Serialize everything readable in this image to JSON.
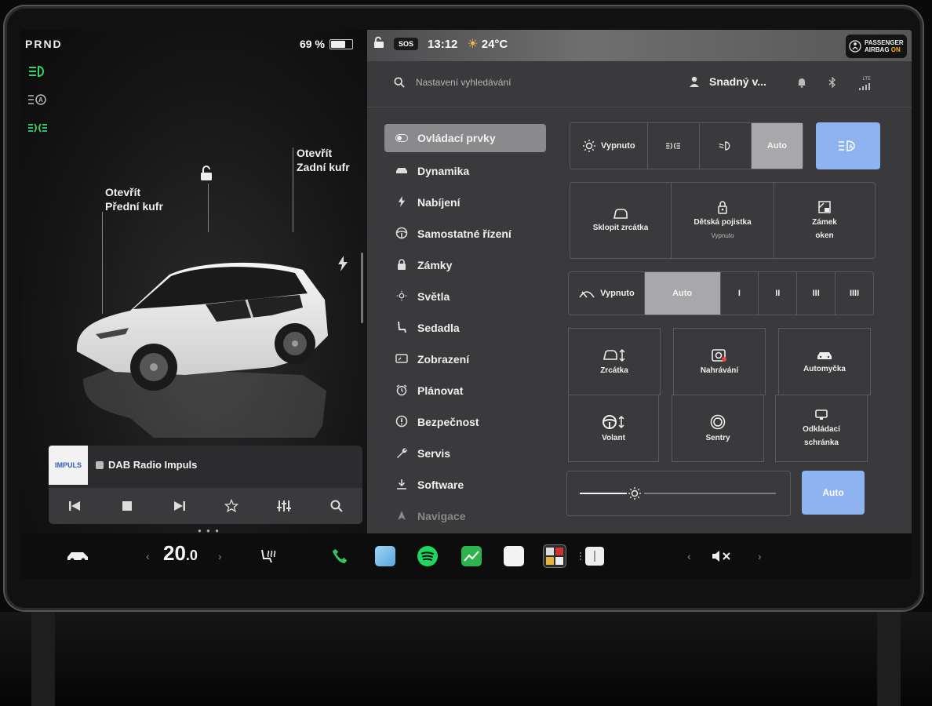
{
  "left": {
    "gear": "PRND",
    "battery_pct": "69 %",
    "battery_level": 0.69,
    "indicators": [
      "headlight-icon",
      "auto-headlight-icon",
      "parking-light-icon"
    ],
    "frunk_label_1": "Otevřít",
    "frunk_label_2": "Přední kufr",
    "trunk_label_1": "Otevřít",
    "trunk_label_2": "Zadní kufr",
    "media": {
      "station": "DAB Radio Impuls",
      "art_text": "IMPULS"
    }
  },
  "status": {
    "sos": "SOS",
    "time": "13:12",
    "temperature": "24°C",
    "airbag_line1": "PASSENGER",
    "airbag_line2": "AIRBAG",
    "airbag_state": "ON"
  },
  "topbar": {
    "search_placeholder": "Nastavení vyhledávání",
    "user": "Snadný v...",
    "network": "LTE"
  },
  "menu": [
    {
      "label": "Ovládací prvky",
      "icon": "toggle-icon"
    },
    {
      "label": "Dynamika",
      "icon": "car-icon"
    },
    {
      "label": "Nabíjení",
      "icon": "bolt-icon"
    },
    {
      "label": "Samostatné řízení",
      "icon": "steering-wheel-icon"
    },
    {
      "label": "Zámky",
      "icon": "lock-icon"
    },
    {
      "label": "Světla",
      "icon": "sun-icon"
    },
    {
      "label": "Sedadla",
      "icon": "seat-icon"
    },
    {
      "label": "Zobrazení",
      "icon": "display-icon"
    },
    {
      "label": "Plánovat",
      "icon": "alarm-icon"
    },
    {
      "label": "Bezpečnost",
      "icon": "alert-icon"
    },
    {
      "label": "Servis",
      "icon": "wrench-icon"
    },
    {
      "label": "Software",
      "icon": "download-icon"
    },
    {
      "label": "Navigace",
      "icon": "navigation-icon"
    }
  ],
  "lights": {
    "off": "Vypnuto",
    "auto": "Auto"
  },
  "tiles1": {
    "mirrors_fold": "Sklopit zrcátka",
    "child_lock": "Dětská pojistka",
    "child_lock_state": "Vypnuto",
    "window_lock_1": "Zámek",
    "window_lock_2": "oken"
  },
  "wipers": {
    "off": "Vypnuto",
    "auto": "Auto",
    "s1": "I",
    "s2": "II",
    "s3": "III",
    "s4": "IIII"
  },
  "tiles2": {
    "mirrors": "Zrcátka",
    "recording": "Nahrávání",
    "carwash": "Automyčka",
    "wheel": "Volant",
    "sentry": "Sentry",
    "glovebox_1": "Odkládací",
    "glovebox_2": "schránka"
  },
  "brightness": {
    "auto": "Auto",
    "level": 0.28
  },
  "dock": {
    "temperature": "20",
    "temperature_decimal": ".0"
  }
}
